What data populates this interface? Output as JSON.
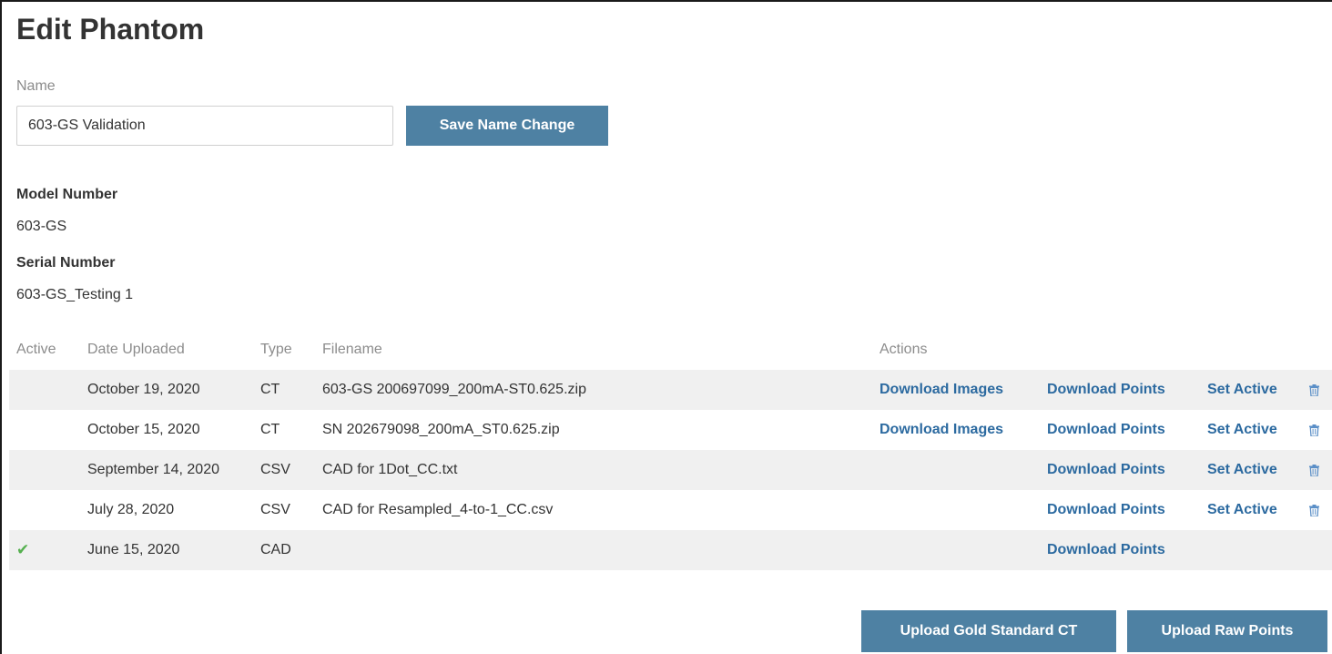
{
  "page": {
    "title": "Edit Phantom"
  },
  "name_field": {
    "label": "Name",
    "value": "603-GS Validation",
    "save_label": "Save Name Change"
  },
  "model": {
    "label": "Model Number",
    "value": "603-GS"
  },
  "serial": {
    "label": "Serial Number",
    "value": "603-GS_Testing 1"
  },
  "table": {
    "headers": {
      "active": "Active",
      "date": "Date Uploaded",
      "type": "Type",
      "filename": "Filename",
      "actions": "Actions"
    },
    "rows": [
      {
        "active": "",
        "date": "October 19, 2020",
        "type": "CT",
        "filename": "603-GS 200697099_200mA-ST0.625.zip",
        "download_images": "Download Images",
        "download_points": "Download Points",
        "set_active": "Set Active",
        "delete_icon": "trash-icon"
      },
      {
        "active": "",
        "date": "October 15, 2020",
        "type": "CT",
        "filename": "SN 202679098_200mA_ST0.625.zip",
        "download_images": "Download Images",
        "download_points": "Download Points",
        "set_active": "Set Active",
        "delete_icon": "trash-icon"
      },
      {
        "active": "",
        "date": "September 14, 2020",
        "type": "CSV",
        "filename": "CAD for 1Dot_CC.txt",
        "download_images": "",
        "download_points": "Download Points",
        "set_active": "Set Active",
        "delete_icon": "trash-icon"
      },
      {
        "active": "",
        "date": "July 28, 2020",
        "type": "CSV",
        "filename": "CAD for Resampled_4-to-1_CC.csv",
        "download_images": "",
        "download_points": "Download Points",
        "set_active": "Set Active",
        "delete_icon": "trash-icon"
      },
      {
        "active": "checkmark-icon",
        "date": "June 15, 2020",
        "type": "CAD",
        "filename": "",
        "download_images": "",
        "download_points": "Download Points",
        "set_active": "",
        "delete_icon": ""
      }
    ]
  },
  "buttons": {
    "upload_gold": "Upload Gold Standard CT",
    "upload_raw": "Upload Raw Points"
  },
  "colors": {
    "button_bg": "#4e81a3",
    "link": "#2c6aa0",
    "stripe": "#f0f0f0",
    "check": "#55b04f",
    "trash": "#5b8fc7"
  }
}
